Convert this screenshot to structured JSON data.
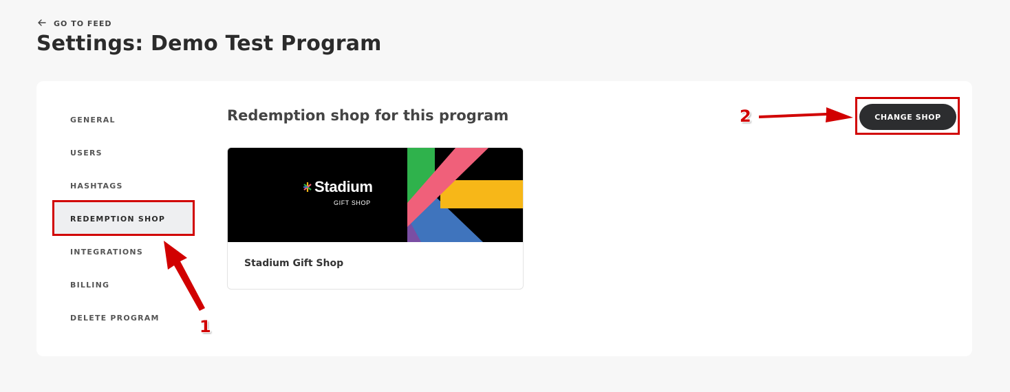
{
  "header": {
    "back_label": "GO TO FEED",
    "title": "Settings: Demo Test Program"
  },
  "sidebar": {
    "items": [
      {
        "label": "GENERAL",
        "active": false
      },
      {
        "label": "USERS",
        "active": false
      },
      {
        "label": "HASHTAGS",
        "active": false
      },
      {
        "label": "REDEMPTION SHOP",
        "active": true
      },
      {
        "label": "INTEGRATIONS",
        "active": false
      },
      {
        "label": "BILLING",
        "active": false
      },
      {
        "label": "DELETE PROGRAM",
        "active": false
      }
    ]
  },
  "main": {
    "section_title": "Redemption shop for this program",
    "change_button_label": "CHANGE SHOP",
    "shop": {
      "brand_name": "Stadium",
      "brand_sub": "GIFT SHOP",
      "name": "Stadium Gift Shop"
    }
  },
  "annotations": {
    "first_number": "1",
    "second_number": "2",
    "color": "#d10000"
  },
  "colors": {
    "button_bg": "#2c2d2f",
    "page_bg": "#f7f7f7",
    "active_item_bg": "#eeeff1",
    "banner_green": "#2fb24c",
    "banner_pink": "#f0607a",
    "banner_yellow": "#f7b718",
    "banner_blue": "#3f74bd",
    "banner_purple": "#7a4ea3"
  }
}
